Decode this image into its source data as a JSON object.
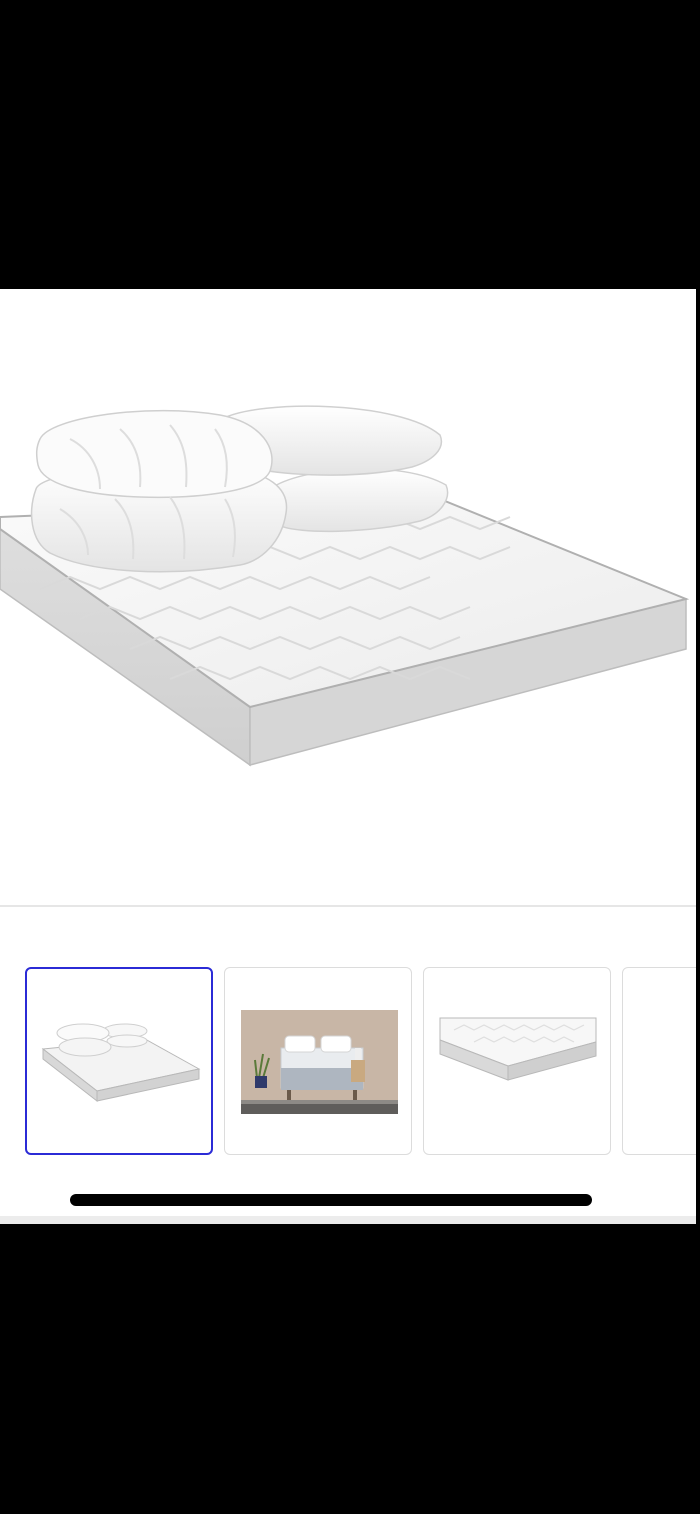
{
  "product_gallery": {
    "main_image": {
      "alt": "",
      "icon": "mattress-with-pillows-and-duvet"
    },
    "thumbnails": [
      {
        "name": "thumbnail-mattress-with-bedding",
        "selected": true
      },
      {
        "name": "thumbnail-bedroom-scene",
        "selected": false
      },
      {
        "name": "thumbnail-mattress-corner",
        "selected": false
      },
      {
        "name": "thumbnail-partial",
        "selected": false
      }
    ],
    "selected_index": 0
  },
  "colors": {
    "background": "#000000",
    "page": "#ffffff",
    "selected_border": "#2b2bd6",
    "thumb_border": "#dcdcdc"
  }
}
